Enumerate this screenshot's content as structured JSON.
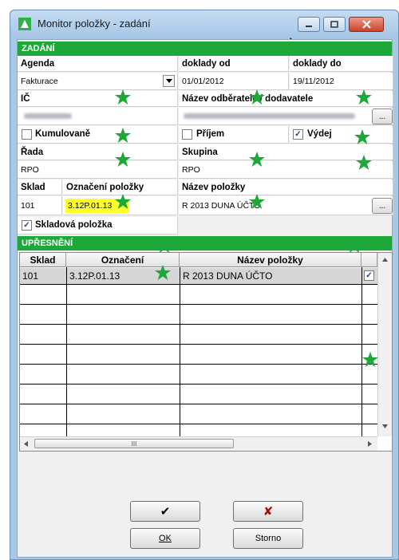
{
  "window": {
    "title": "Monitor položky - zadání"
  },
  "zadani": {
    "section_label": "ZADÁNÍ",
    "agenda": {
      "label": "Agenda",
      "value": "Fakturace"
    },
    "doklady_od": {
      "label": "doklady od",
      "value": "01/01/2012"
    },
    "doklady_do": {
      "label": "doklady do",
      "value": "19/11/2012"
    },
    "ic": {
      "label": "IČ"
    },
    "nazev_odberatele": {
      "label": "Název odběratele / dodavatele"
    },
    "kumulovane": {
      "label": "Kumulovaně",
      "checked": false
    },
    "prijem": {
      "label": "Příjem",
      "checked": false
    },
    "vydej": {
      "label": "Výdej",
      "checked": true
    },
    "rada": {
      "label": "Řada",
      "value": "RPO"
    },
    "skupina": {
      "label": "Skupina",
      "value": "RPO"
    },
    "sklad": {
      "label": "Sklad",
      "value": "101"
    },
    "oznaceni_polozky": {
      "label": "Označení položky",
      "value": "3.12P.01.13"
    },
    "nazev_polozky": {
      "label": "Název položky",
      "value": "R 2013 DUNA ÚČTO"
    },
    "skladova_polozka": {
      "label": "Skladová položka",
      "checked": true
    },
    "browse_label": "..."
  },
  "upresneni": {
    "section_label": "UPŘESNĚNÍ",
    "columns": [
      "Sklad",
      "Označení",
      "Název položky"
    ],
    "rows": [
      {
        "sklad": "101",
        "oznaceni": "3.12P.01.13",
        "nazev": "R 2013 DUNA ÚČTO",
        "checked": true
      }
    ],
    "hscroll_grip": "III"
  },
  "buttons": {
    "check_all": "✔",
    "uncheck_all": "✘",
    "ok": "OK",
    "storno": "Storno"
  },
  "colors": {
    "section_green": "#1fa83a",
    "highlight_yellow": "#ffff2a",
    "star_green": "#1fa83a"
  },
  "icons": [
    "app-icon",
    "minimize-icon",
    "maximize-icon",
    "close-icon",
    "star-icon",
    "dropdown-arrow-icon",
    "checkmark-icon",
    "uncheck-icon",
    "scroll-arrow-icon",
    "mouse-cursor-icon"
  ]
}
